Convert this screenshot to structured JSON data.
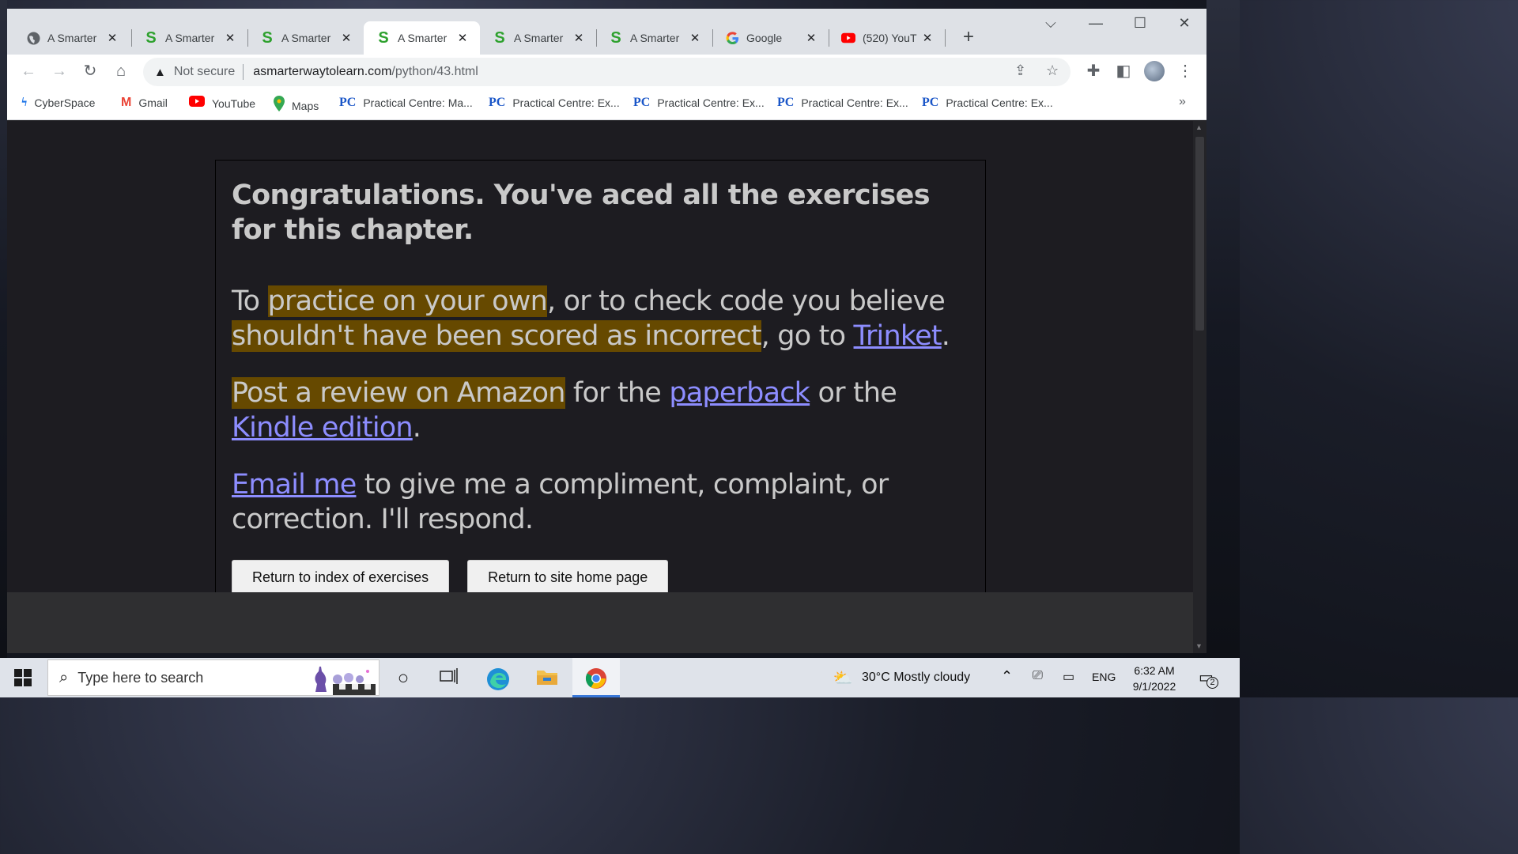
{
  "tabs": [
    {
      "title": "A Smarter",
      "favicon": "globe-icon"
    },
    {
      "title": "A Smarter",
      "favicon": "s-logo-icon"
    },
    {
      "title": "A Smarter",
      "favicon": "s-logo-icon"
    },
    {
      "title": "A Smarter",
      "favicon": "s-logo-icon",
      "active": true
    },
    {
      "title": "A Smarter",
      "favicon": "s-logo-icon"
    },
    {
      "title": "A Smarter",
      "favicon": "s-logo-icon"
    },
    {
      "title": "Google",
      "favicon": "google-icon"
    },
    {
      "title": "(520) YouT",
      "favicon": "youtube-icon"
    }
  ],
  "toolbar": {
    "security_label": "Not secure",
    "url_host": "asmarterwaytolearn.com",
    "url_path": "/python/43.html"
  },
  "bookmarks": [
    {
      "label": "CyberSpace",
      "icon": "cyberspace-icon"
    },
    {
      "label": "Gmail",
      "icon": "gmail-icon"
    },
    {
      "label": "YouTube",
      "icon": "youtube-icon"
    },
    {
      "label": "Maps",
      "icon": "maps-icon"
    },
    {
      "label": "Practical Centre: Ma...",
      "icon": "pc-icon"
    },
    {
      "label": "Practical Centre: Ex...",
      "icon": "pc-icon"
    },
    {
      "label": "Practical Centre: Ex...",
      "icon": "pc-icon"
    },
    {
      "label": "Practical Centre: Ex...",
      "icon": "pc-icon"
    },
    {
      "label": "Practical Centre: Ex...",
      "icon": "pc-icon"
    }
  ],
  "page": {
    "heading": "Congratulations. You've aced all the exercises for this chapter.",
    "p1": {
      "t1": "To ",
      "hl1": "practice on your own",
      "t2": ", or to check code you believe ",
      "hl2": "shouldn't have been scored as incorrect",
      "t3": ", go to ",
      "link": "Trinket",
      "t4": "."
    },
    "p2": {
      "hl": "Post a review on Amazon",
      "t1": " for the ",
      "link1": "paperback",
      "t2": " or the ",
      "link2": "Kindle edition",
      "t3": "."
    },
    "p3": {
      "link": "Email me",
      "t1": " to give me a compliment, complaint, or correction. I'll respond."
    },
    "buttons": {
      "index": "Return to index of exercises",
      "home": "Return to site home page"
    }
  },
  "taskbar": {
    "search_placeholder": "Type here to search",
    "weather": "30°C  Mostly cloudy",
    "language": "ENG",
    "time": "6:32 AM",
    "date": "9/1/2022",
    "notification_count": "2"
  },
  "colors": {
    "page_bg": "#1d1c21",
    "highlight": "#664900",
    "link": "#8d8dff",
    "favicon_green": "#2ea12e"
  }
}
